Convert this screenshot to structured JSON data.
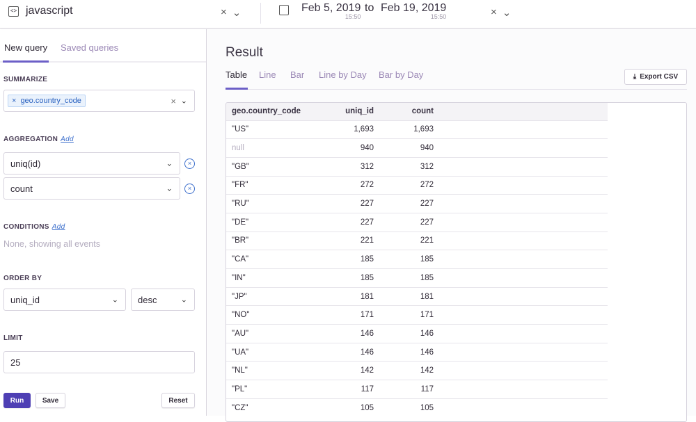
{
  "header": {
    "project": "javascript",
    "date_from": "Feb 5, 2019",
    "time_from": "15:50",
    "to": "to",
    "date_to": "Feb 19, 2019",
    "time_to": "15:50",
    "clear": "×",
    "chevron": "⌄"
  },
  "sidebar": {
    "tabs": [
      "New query",
      "Saved queries"
    ],
    "summarize_label": "SUMMARIZE",
    "summarize_chip": "geo.country_code",
    "aggregation_label": "AGGREGATION",
    "add": "Add",
    "aggregations": [
      "uniq(id)",
      "count"
    ],
    "conditions_label": "CONDITIONS",
    "conditions_empty": "None, showing all events",
    "orderby_label": "ORDER BY",
    "orderby_field": "uniq_id",
    "orderby_dir": "desc",
    "limit_label": "LIMIT",
    "limit_value": "25",
    "run": "Run",
    "save": "Save",
    "reset": "Reset"
  },
  "result": {
    "title": "Result",
    "tabs": [
      "Table",
      "Line",
      "Bar",
      "Line by Day",
      "Bar by Day"
    ],
    "export": "Export CSV",
    "columns": [
      "geo.country_code",
      "uniq_id",
      "count"
    ],
    "rows": [
      [
        "\"US\"",
        "1,693",
        "1,693"
      ],
      [
        "null",
        "940",
        "940"
      ],
      [
        "\"GB\"",
        "312",
        "312"
      ],
      [
        "\"FR\"",
        "272",
        "272"
      ],
      [
        "\"RU\"",
        "227",
        "227"
      ],
      [
        "\"DE\"",
        "227",
        "227"
      ],
      [
        "\"BR\"",
        "221",
        "221"
      ],
      [
        "\"CA\"",
        "185",
        "185"
      ],
      [
        "\"IN\"",
        "185",
        "185"
      ],
      [
        "\"JP\"",
        "181",
        "181"
      ],
      [
        "\"NO\"",
        "171",
        "171"
      ],
      [
        "\"AU\"",
        "146",
        "146"
      ],
      [
        "\"UA\"",
        "146",
        "146"
      ],
      [
        "\"NL\"",
        "142",
        "142"
      ],
      [
        "\"PL\"",
        "117",
        "117"
      ],
      [
        "\"CZ\"",
        "105",
        "105"
      ]
    ]
  }
}
